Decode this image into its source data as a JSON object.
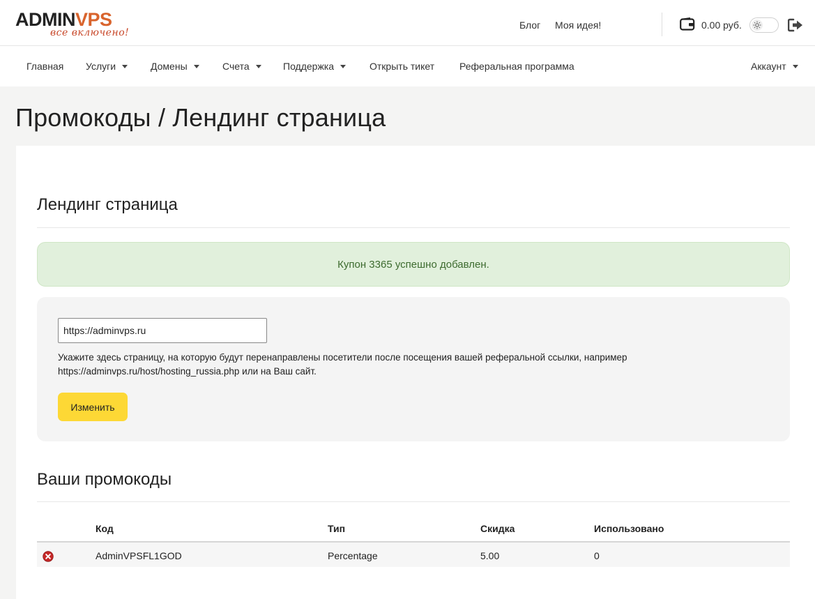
{
  "brand": {
    "logo_part1": "ADMIN",
    "logo_part2": "VPS",
    "tagline": "все включено!",
    "accent_color": "#d9642d"
  },
  "header": {
    "links": [
      "Блог",
      "Моя идея!"
    ],
    "balance": "0.00 руб.",
    "icons": [
      "wallet-icon",
      "sun-icon",
      "logout-icon"
    ]
  },
  "nav": {
    "items": [
      {
        "label": "Главная",
        "dropdown": false
      },
      {
        "label": "Услуги",
        "dropdown": true
      },
      {
        "label": "Домены",
        "dropdown": true
      },
      {
        "label": "Счета",
        "dropdown": true
      },
      {
        "label": "Поддержка",
        "dropdown": true
      },
      {
        "label": "Открыть тикет",
        "dropdown": false
      },
      {
        "label": "Реферальная программа",
        "dropdown": false
      }
    ],
    "account": {
      "label": "Аккаунт",
      "dropdown": true
    }
  },
  "page": {
    "title": "Промокоды / Лендинг страница"
  },
  "landing": {
    "section_title": "Лендинг страница",
    "alert": "Купон 3365 успешно добавлен.",
    "alert_color": "#e1f0dc",
    "url_value": "https://adminvps.ru",
    "hint": "Укажите здесь страницу, на которую будут перенаправлены посетители после посещения вашей реферальной ссылки, например https://adminvps.ru/host/hosting_russia.php или на Ваш сайт.",
    "submit_label": "Изменить",
    "button_color": "#fdd835"
  },
  "promocodes": {
    "section_title": "Ваши промокоды",
    "columns": [
      "Код",
      "Тип",
      "Скидка",
      "Использовано"
    ],
    "rows": [
      {
        "code": "AdminVPSFL1GOD",
        "type": "Percentage",
        "discount": "5.00",
        "used": "0"
      }
    ]
  }
}
